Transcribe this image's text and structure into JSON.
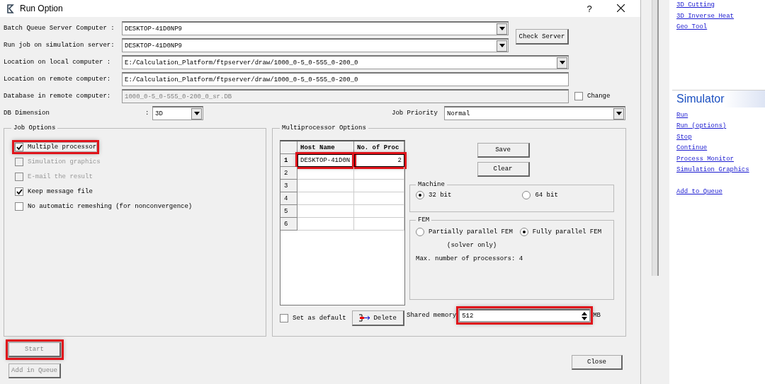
{
  "window": {
    "title": "Run Option",
    "help": "?"
  },
  "fields": [
    {
      "kind": "combo",
      "label": "Batch Queue Server Computer :",
      "value": "DESKTOP-41D0NP9"
    },
    {
      "kind": "combo",
      "label": "Run job on simulation server:",
      "value": "DESKTOP-41D0NP9"
    },
    {
      "kind": "combo",
      "label": "Location on local computer :",
      "value": "E:/Calculation_Platform/ftpserver/draw/1000_0-5_0-555_0-200_0"
    },
    {
      "kind": "text",
      "label": "Location on remote computer:",
      "value": "E:/Calculation_Platform/ftpserver/draw/1000_0-5_0-555_0-200_0",
      "disabled": false
    },
    {
      "kind": "text",
      "label": "Database in remote computer:",
      "value": "1000_0-5_0-555_0-200_0_sr.DB",
      "disabled": true
    }
  ],
  "check_server_button": "Check Server",
  "change": {
    "label": "Change",
    "checked": false
  },
  "db_dimension": {
    "label": "DB Dimension",
    "colon": ":",
    "value": "3D"
  },
  "job_priority": {
    "label": "Job Priority",
    "value": "Normal"
  },
  "job_options": {
    "title": "Job Options",
    "items": [
      {
        "label": "Multiple processor",
        "checked": true,
        "disabled": false,
        "highlighted": true
      },
      {
        "label": "Simulation graphics",
        "checked": false,
        "disabled": true,
        "highlighted": false
      },
      {
        "label": "E-mail the result",
        "checked": false,
        "disabled": true,
        "highlighted": false
      },
      {
        "label": "Keep message file",
        "checked": true,
        "disabled": false,
        "highlighted": false
      },
      {
        "label": "No automatic remeshing (for nonconvergence)",
        "checked": false,
        "disabled": false,
        "highlighted": false
      }
    ]
  },
  "multiprocessor": {
    "title": "Multiprocessor Options",
    "table": {
      "columns": [
        "Host Name",
        "No. of Proc"
      ],
      "rows": [
        {
          "index": "1",
          "cells": [
            "DESKTOP-41D0N",
            "2"
          ],
          "highlighted": true
        },
        {
          "index": "2",
          "cells": [],
          "highlighted": false
        },
        {
          "index": "3",
          "cells": [],
          "highlighted": false
        },
        {
          "index": "4",
          "cells": [],
          "highlighted": false
        },
        {
          "index": "5",
          "cells": [],
          "highlighted": false
        },
        {
          "index": "6",
          "cells": [],
          "highlighted": false
        }
      ]
    },
    "buttons": [
      "Save",
      "Clear"
    ],
    "machine": {
      "title": "Machine",
      "options": [
        {
          "label": "32 bit",
          "selected": true
        },
        {
          "label": "64 bit",
          "selected": false
        }
      ]
    },
    "fem": {
      "title": "FEM",
      "options": [
        {
          "label": "Partially parallel FEM",
          "selected": false
        },
        {
          "label": "Fully parallel FEM",
          "selected": true
        }
      ],
      "note": "(solver only)",
      "max_processors": "Max. number of processors: 4"
    },
    "set_as_default": {
      "label": "Set as default",
      "checked": false
    },
    "delete_button": "Delete",
    "shared_memory": {
      "label": "Shared memory",
      "value": "512",
      "unit": "MB",
      "highlighted": true
    }
  },
  "start_button": {
    "label": "Start",
    "disabled": true,
    "highlighted": true
  },
  "add_in_queue_button": {
    "label": "Add in Queue",
    "disabled": true,
    "highlighted": false
  },
  "close_button": "Close",
  "side_panel": {
    "top_links": [
      "3D Cutting",
      "3D Inverse Heat",
      "Geo Tool"
    ],
    "section_title": "Simulator",
    "links": [
      "Run",
      "Run (options)",
      "Stop",
      "Continue",
      "Process Monitor",
      "Simulation Graphics"
    ],
    "queue_links": [
      "Add to Queue"
    ]
  }
}
